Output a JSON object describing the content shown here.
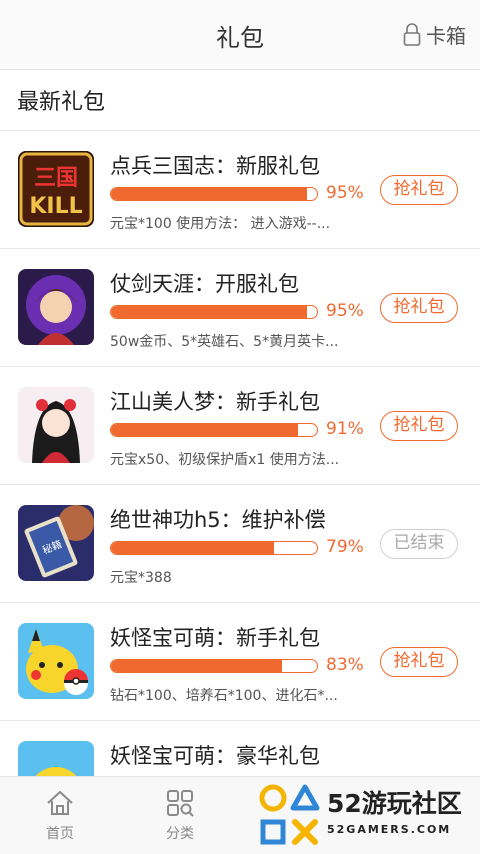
{
  "header": {
    "title": "礼包",
    "card_box_label": "卡箱",
    "card_box_icon": "lock-icon"
  },
  "section": {
    "title": "最新礼包"
  },
  "items": [
    {
      "title": "点兵三国志：新服礼包",
      "progress": 95,
      "percent_label": "95%",
      "desc": "元宝*100 使用方法： 进入游戏--...",
      "button": "抢礼包",
      "status": "active"
    },
    {
      "title": "仗剑天涯：开服礼包",
      "progress": 95,
      "percent_label": "95%",
      "desc": "50w金币、5*英雄石、5*黄月英卡...",
      "button": "抢礼包",
      "status": "active"
    },
    {
      "title": "江山美人梦：新手礼包",
      "progress": 91,
      "percent_label": "91%",
      "desc": "元宝x50、初级保护盾x1 使用方法...",
      "button": "抢礼包",
      "status": "active"
    },
    {
      "title": "绝世神功h5：维护补偿",
      "progress": 79,
      "percent_label": "79%",
      "desc": "元宝*388",
      "button": "已结束",
      "status": "ended"
    },
    {
      "title": "妖怪宝可萌：新手礼包",
      "progress": 83,
      "percent_label": "83%",
      "desc": "钻石*100、培养石*100、进化石*...",
      "button": "抢礼包",
      "status": "active"
    },
    {
      "title": "妖怪宝可萌：豪华礼包",
      "progress": 0,
      "percent_label": "",
      "desc": "",
      "button": "",
      "status": "active"
    }
  ],
  "tabbar": {
    "tabs": [
      {
        "label": "首页",
        "icon": "home-icon"
      },
      {
        "label": "分类",
        "icon": "category-icon"
      }
    ]
  },
  "watermark": {
    "text": "52游玩社区",
    "sub": "52GAMERS.COM"
  },
  "colors": {
    "accent": "#f06a2f",
    "ended": "#aaaaaa"
  }
}
